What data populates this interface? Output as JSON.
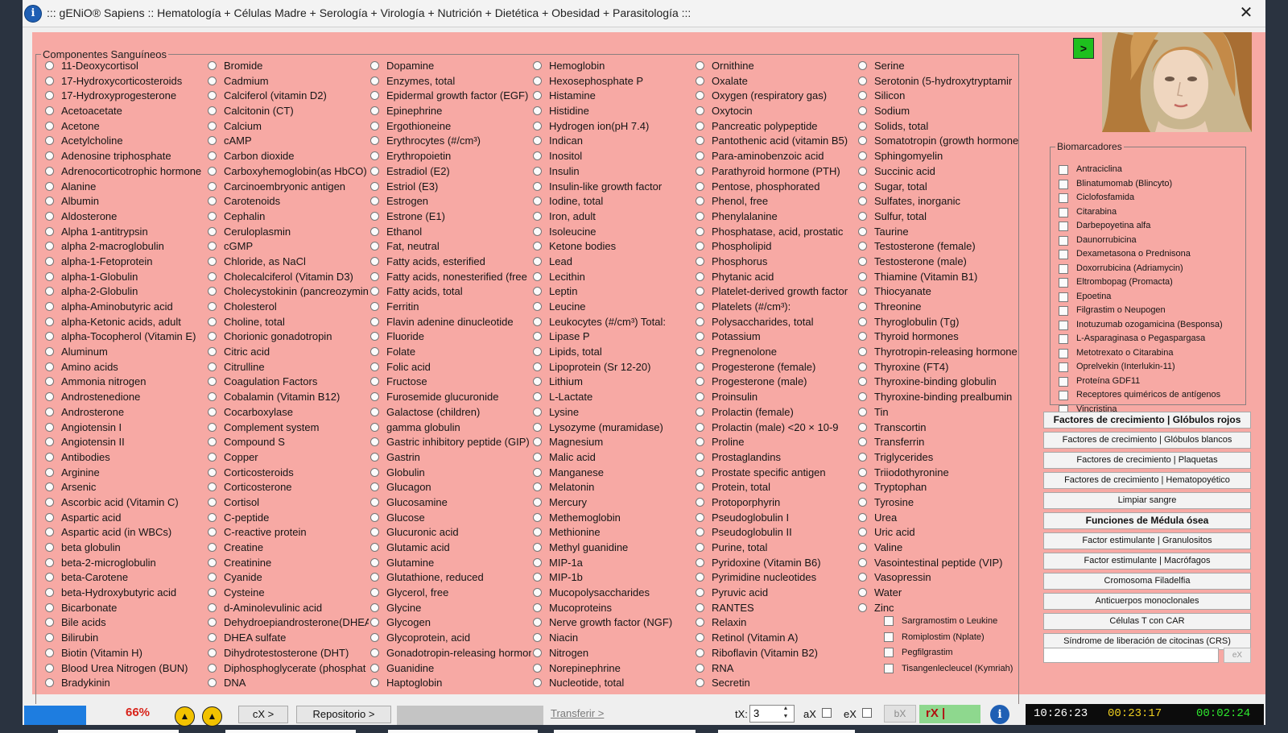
{
  "window": {
    "title": "::: gENiO® Sapiens :: Hematología + Células Madre + Serología + Virología + Nutrición + Dietética + Obesidad + Parasitología :::",
    "close": "✕"
  },
  "components": {
    "legend": "Componentes Sanguíneos",
    "columns": [
      [
        "11-Deoxycortisol",
        "17-Hydroxycorticosteroids",
        "17-Hydroxyprogesterone",
        "Acetoacetate",
        "Acetone",
        "Acetylcholine",
        "Adenosine triphosphate",
        "Adrenocorticotrophic hormone",
        "Alanine",
        "Albumin",
        "Aldosterone",
        "Alpha 1-antitrypsin",
        "alpha 2-macroglobulin",
        "alpha-1-Fetoprotein",
        "alpha-1-Globulin",
        "alpha-2-Globulin",
        "alpha-Aminobutyric acid",
        "alpha-Ketonic acids, adult",
        "alpha-Tocopherol (Vitamin E)",
        "Aluminum",
        "Amino acids",
        "Ammonia nitrogen",
        "Androstenedione",
        "Androsterone",
        "Angiotensin I",
        "Angiotensin II",
        "Antibodies",
        "Arginine",
        "Arsenic",
        "Ascorbic acid (Vitamin C)",
        "Aspartic acid",
        "Aspartic acid (in WBCs)",
        "beta globulin",
        "beta-2-microglobulin",
        "beta-Carotene",
        "beta-Hydroxybutyric acid",
        "Bicarbonate",
        "Bile acids",
        "Bilirubin",
        "Biotin (Vitamin H)",
        "Blood Urea Nitrogen (BUN)",
        "Bradykinin"
      ],
      [
        "Bromide",
        "Cadmium",
        "Calciferol (vitamin D2)",
        "Calcitonin (CT)",
        "Calcium",
        "cAMP",
        "Carbon dioxide",
        "Carboxyhemoglobin(as HbCO)",
        "Carcinoembryonic antigen",
        "Carotenoids",
        "Cephalin",
        "Ceruloplasmin",
        "cGMP",
        "Chloride, as NaCl",
        "Cholecalciferol (Vitamin D3)",
        "Cholecystokinin (pancreozymin",
        "Cholesterol",
        "Choline, total",
        "Chorionic gonadotropin",
        "Citric acid",
        "Citrulline",
        "Coagulation Factors",
        "Cobalamin (Vitamin B12)",
        "Cocarboxylase",
        "Complement system",
        "Compound S",
        "Copper",
        "Corticosteroids",
        "Corticosterone",
        "Cortisol",
        "C-peptide",
        "C-reactive protein",
        "Creatine",
        "Creatinine",
        "Cyanide",
        "Cysteine",
        "d-Aminolevulinic acid",
        "Dehydroepiandrosterone(DHEA",
        "DHEA sulfate",
        "Dihydrotestosterone (DHT)",
        "Diphosphoglycerate (phosphat",
        "DNA"
      ],
      [
        "Dopamine",
        "Enzymes, total",
        "Epidermal growth factor (EGF)",
        "Epinephrine",
        "Ergothioneine",
        "Erythrocytes (#/cm³)",
        "Erythropoietin",
        "Estradiol (E2)",
        "Estriol (E3)",
        "Estrogen",
        "Estrone (E1)",
        "Ethanol",
        "Fat, neutral",
        "Fatty acids, esterified",
        "Fatty acids, nonesterified (free",
        "Fatty acids, total",
        "Ferritin",
        "Flavin adenine dinucleotide",
        "Fluoride",
        "Folate",
        "Folic acid",
        "Fructose",
        "Furosemide glucuronide",
        "Galactose (children)",
        "gamma globulin",
        "Gastric inhibitory peptide (GIP)",
        "Gastrin",
        "Globulin",
        "Glucagon",
        "Glucosamine",
        "Glucose",
        "Glucuronic acid",
        "Glutamic acid",
        "Glutamine",
        "Glutathione, reduced",
        "Glycerol, free",
        "Glycine",
        "Glycogen",
        "Glycoprotein, acid",
        "Gonadotropin-releasing hormor",
        "Guanidine",
        "Haptoglobin"
      ],
      [
        "Hemoglobin",
        "Hexosephosphate P",
        "Histamine",
        "Histidine",
        "Hydrogen ion(pH 7.4)",
        "Indican",
        "Inositol",
        "Insulin",
        "Insulin-like growth factor",
        "Iodine, total",
        "Iron, adult",
        "Isoleucine",
        "Ketone bodies",
        "Lead",
        "Lecithin",
        "Leptin",
        "Leucine",
        "Leukocytes (#/cm³) Total:",
        "Lipase P",
        "Lipids, total",
        "Lipoprotein (Sr 12-20)",
        "Lithium",
        "L-Lactate",
        "Lysine",
        "Lysozyme (muramidase)",
        "Magnesium",
        "Malic acid",
        "Manganese",
        "Melatonin",
        "Mercury",
        "Methemoglobin",
        "Methionine",
        "Methyl guanidine",
        "MIP-1a",
        "MIP-1b",
        "Mucopolysaccharides",
        "Mucoproteins",
        "Nerve growth factor (NGF)",
        "Niacin",
        "Nitrogen",
        "Norepinephrine",
        "Nucleotide, total"
      ],
      [
        "Ornithine",
        "Oxalate",
        "Oxygen (respiratory gas)",
        "Oxytocin",
        "Pancreatic polypeptide",
        "Pantothenic acid (vitamin B5)",
        "Para-aminobenzoic acid",
        "Parathyroid hormone (PTH)",
        "Pentose, phosphorated",
        "Phenol, free",
        "Phenylalanine",
        "Phosphatase, acid, prostatic",
        "Phospholipid",
        "Phosphorus",
        "Phytanic acid",
        "Platelet-derived growth factor",
        "Platelets (#/cm³):",
        "Polysaccharides, total",
        "Potassium",
        "Pregnenolone",
        "Progesterone (female)",
        "Progesterone (male)",
        "Proinsulin",
        "Prolactin (female)",
        "Prolactin (male) <20 × 10-9",
        "Proline",
        "Prostaglandins",
        "Prostate specific antigen",
        "Protein, total",
        "Protoporphyrin",
        "Pseudoglobulin I",
        "Pseudoglobulin II",
        "Purine, total",
        "Pyridoxine (Vitamin B6)",
        "Pyrimidine nucleotides",
        "Pyruvic acid",
        "RANTES",
        "Relaxin",
        "Retinol (Vitamin A)",
        "Riboflavin (Vitamin B2)",
        "RNA",
        "Secretin"
      ],
      [
        "Serine",
        "Serotonin (5-hydroxytryptamir",
        "Silicon",
        "Sodium",
        "Solids, total",
        "Somatotropin (growth hormone",
        "Sphingomyelin",
        "Succinic acid",
        "Sugar, total",
        "Sulfates, inorganic",
        "Sulfur, total",
        "Taurine",
        "Testosterone (female)",
        "Testosterone (male)",
        "Thiamine (Vitamin B1)",
        "Thiocyanate",
        "Threonine",
        "Thyroglobulin (Tg)",
        "Thyroid hormones",
        "Thyrotropin-releasing hormone",
        "Thyroxine (FT4)",
        "Thyroxine-binding globulin",
        "Thyroxine-binding prealbumin",
        "Tin",
        "Transcortin",
        "Transferrin",
        "Triglycerides",
        "Triiodothyronine",
        "Tryptophan",
        "Tyrosine",
        "Urea",
        "Uric acid",
        "Valine",
        "Vasointestinal peptide (VIP)",
        "Vasopressin",
        "Water",
        "Zinc"
      ]
    ],
    "extra_checkboxes": [
      "Sargramostim o Leukine",
      "Romiplostim (Nplate)",
      "Pegfilgrastim",
      "Tisangenlecleucel (Kymriah)"
    ]
  },
  "biomarkers": {
    "legend": "Biomarcadores",
    "items": [
      "Antraciclina",
      "Blinatumomab (Blincyto)",
      "Ciclofosfamida",
      "Citarabina",
      "Darbepoyetina alfa",
      "Daunorrubicina",
      "Dexametasona o Prednisona",
      "Doxorrubicina (Adriamycin)",
      "Eltrombopag (Promacta)",
      "Epoetina",
      "Filgrastim o Neupogen",
      "Inotuzumab ozogamicina (Besponsa)",
      "L-Asparaginasa o Pegaspargasa",
      "Metotrexato o Citarabina",
      "Oprelvekin (Interlukin-11)",
      "Proteína GDF11",
      "Receptores quiméricos de antígenos",
      "Vincristina"
    ]
  },
  "arrow_button": ">",
  "side_buttons": [
    {
      "label": "Factores de crecimiento | Glóbulos rojos",
      "bold": true
    },
    {
      "label": "Factores de crecimiento | Glóbulos blancos",
      "bold": false
    },
    {
      "label": "Factores de crecimiento | Plaquetas",
      "bold": false
    },
    {
      "label": "Factores de crecimiento | Hematopoyético",
      "bold": false
    },
    {
      "label": "Limpiar sangre",
      "bold": false
    },
    {
      "label": "Funciones de Médula ósea",
      "bold": true
    },
    {
      "label": "Factor estimulante | Granulositos",
      "bold": false
    },
    {
      "label": "Factor estimulante | Macrófagos",
      "bold": false
    },
    {
      "label": "Cromosoma Filadelfia",
      "bold": false
    },
    {
      "label": "Anticuerpos monoclonales",
      "bold": false
    },
    {
      "label": "Células T con CAR",
      "bold": false
    },
    {
      "label": "Síndrome de liberación de citocinas (CRS)",
      "bold": false
    }
  ],
  "side_ex_label": "eX",
  "status": {
    "zoom": "66%",
    "cx_button": "cX >",
    "repo_button": "Repositorio >",
    "transfer_link": "Transferir >",
    "tx_label": "tX:",
    "tx_value": "3",
    "ax_label": "aX",
    "ex_label": "eX",
    "bx_button": "bX",
    "rx_label": "rX |",
    "time_1": "10:26:23",
    "time_2": "00:23:17",
    "time_3": "00:02:24"
  },
  "colors": {
    "panel": "#f7a9a4",
    "time_1": "#ffffff",
    "time_2": "#f0d020",
    "time_3": "#2ee82e"
  }
}
